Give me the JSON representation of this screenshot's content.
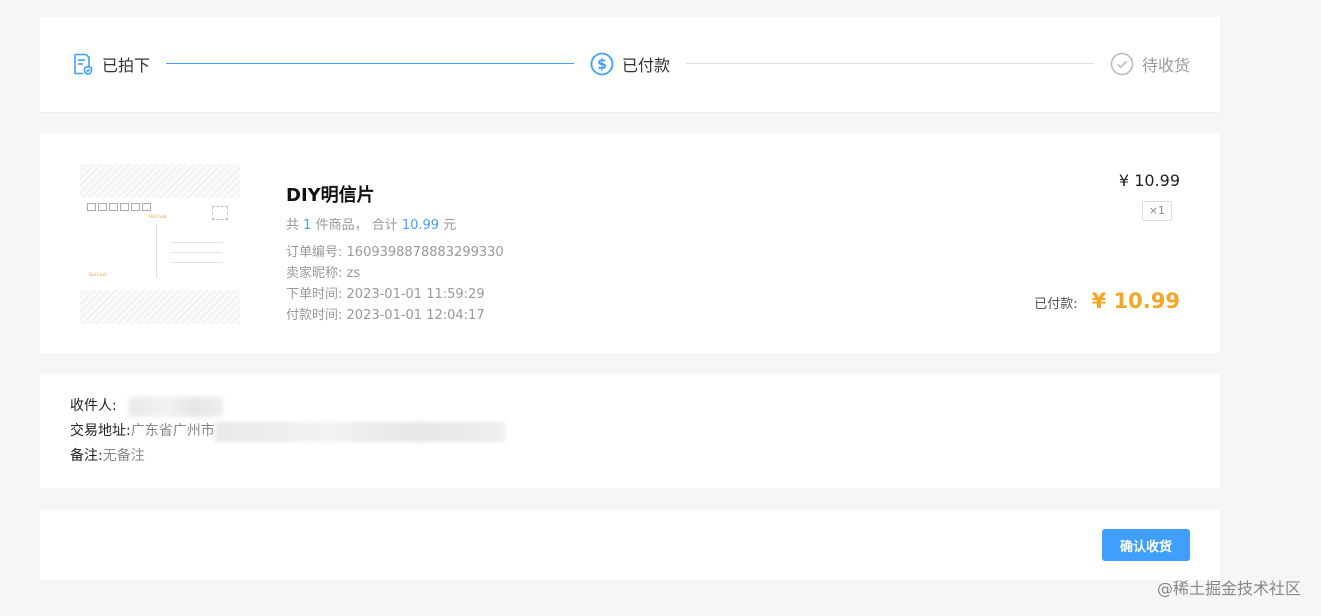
{
  "steps": [
    {
      "label": "已拍下",
      "icon": "order-doc-icon",
      "state": "done"
    },
    {
      "label": "已付款",
      "icon": "dollar-circle-icon",
      "state": "current"
    },
    {
      "label": "待收货",
      "icon": "check-circle-icon",
      "state": "pending"
    }
  ],
  "product": {
    "title": "DIY明信片",
    "summary_prefix": "共",
    "count": "1",
    "summary_mid": "件商品， 合计",
    "total": "10.99",
    "summary_suffix": "元",
    "unit_price": "¥ 10.99",
    "quantity": "×1",
    "paid_label": "已付款:",
    "paid_amount": "¥ 10.99",
    "info": [
      {
        "key": "订单编号:",
        "value": "1609398878883299330"
      },
      {
        "key": "卖家昵称:",
        "value": "zs"
      },
      {
        "key": "下单时间:",
        "value": "2023-01-01 11:59:29"
      },
      {
        "key": "付款时间:",
        "value": "2023-01-01 12:04:17"
      }
    ]
  },
  "address": {
    "recipient_label": "收件人:",
    "address_label": "交易地址:",
    "address_value": "广东省广州市",
    "note_label": "备注:",
    "note_value": "无备注"
  },
  "footer": {
    "confirm_label": "确认收货"
  },
  "watermark": "@稀土掘金技术社区",
  "colors": {
    "accent": "#409eff",
    "price": "#f5a623",
    "pending": "#bbbbbb"
  }
}
